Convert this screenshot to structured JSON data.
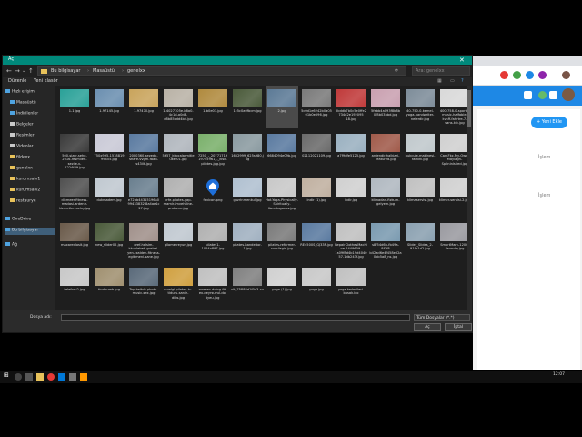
{
  "dialog": {
    "title": "Aç",
    "breadcrumb": [
      "Bu bilgisayar",
      "Masaüstü",
      "genelxx"
    ],
    "search_placeholder": "Ara: genelxx",
    "toolbar": [
      "Düzenle",
      "Yeni klasör"
    ],
    "sidebar": [
      {
        "label": "Hızlı erişim",
        "color": "#4fa3e0"
      },
      {
        "label": "Masaüstü",
        "color": "#4fa3e0"
      },
      {
        "label": "İndirilenler",
        "color": "#4fa3e0"
      },
      {
        "label": "Belgeler",
        "color": "#c9c9c9"
      },
      {
        "label": "Resimler",
        "color": "#c9c9c9"
      },
      {
        "label": "Videolar",
        "color": "#c9c9c9"
      },
      {
        "label": "fildexx",
        "color": "#e8c25a"
      },
      {
        "label": "genelxx",
        "color": "#e8c25a"
      },
      {
        "label": "kurumsalv1",
        "color": "#e8c25a"
      },
      {
        "label": "kurumsalv2",
        "color": "#e8c25a"
      },
      {
        "label": "restaurye",
        "color": "#e8c25a"
      },
      {
        "label": "OneDrive",
        "color": "#4fa3e0"
      },
      {
        "label": "Bu bilgisayar",
        "color": "#4fa3e0",
        "selected": true
      },
      {
        "label": "Ağ",
        "color": "#4fa3e0"
      }
    ],
    "files": [
      {
        "name": "1-1.jpg",
        "color": "#2aa198"
      },
      {
        "name": "1-97145.jpg",
        "color": "#6b8fb0"
      },
      {
        "name": "1-97470.jpg",
        "color": "#c9a45c"
      },
      {
        "name": "1-4027105e-b8a0-4c1d-a0d8-d8b85cdd4b4.jpg",
        "color": "#b9b2a6"
      },
      {
        "name": "1-b0e01.jpg",
        "color": "#b08a3e"
      },
      {
        "name": "1c5c0a0fbcm.jpg",
        "color": "#4a5a3a"
      },
      {
        "name": "2.jpg",
        "color": "#5c7a96",
        "selected": true
      },
      {
        "name": "5c0d1e6242b0a0501b0e596.jpg",
        "color": "#7a7a7a"
      },
      {
        "name": "5bddb7b0c5e0ffe2734d2e192095 18.jpg",
        "color": "#c03a3a"
      },
      {
        "name": "5febb4a093f8b8b 0f8b03bbd.jpg",
        "color": "#c9a0b0"
      },
      {
        "name": "40-750-0-kemel-yoga-handwriter-nelerdir.jpg",
        "color": "#7d8c99"
      },
      {
        "name": "400-758-0-sports-music-halfable-kvsff-fahrtre-7-sans-kik.jpg",
        "color": "#d9d9d9"
      },
      {
        "name": "500-sizer-sehe-2016-resmilerl-sezile-v-2224f69.jpg",
        "color": "#3a3a3a"
      },
      {
        "name": "750x995-1518819 99455.jpg",
        "color": "#c9c9d6"
      },
      {
        "name": "2000360-sezedo-share-vvgm-f8ab-s43ilk.jpg",
        "color": "#5a7aa0"
      },
      {
        "name": "5657_kkocalarmitleuker01.jpg",
        "color": "#b0b6bd"
      },
      {
        "name": "7250_-_20771719 19745961_-_kisd-pilotes-jpg.jpg",
        "color": "#7ab06b"
      },
      {
        "name": "1652999_625s980.jpg",
        "color": "#8a9aa0"
      },
      {
        "name": "6684094e09b.jpg",
        "color": "#5a7aa0"
      },
      {
        "name": "02112021109.jpg",
        "color": "#6a6a6a"
      },
      {
        "name": "a7f9dfe5125.jpg",
        "color": "#9ab0c0"
      },
      {
        "name": "ardendir-halkiari-featured.jpg",
        "color": "#a05a4a"
      },
      {
        "name": "bukcule-makinesi-famini.jpg",
        "color": "#c0c8cc"
      },
      {
        "name": "Can-Fkz-My-Own-Maylagn-Spkninlsired.jpg",
        "color": "#d0d0d0"
      },
      {
        "name": "dikmeer-fitness-madasi-ardenir-hizmetlen-selxy.jpg",
        "color": "#505050"
      },
      {
        "name": "dukmadem.jpg",
        "color": "#c0c8d0"
      },
      {
        "name": "e72bb44315196a099433832f8a4ae1c27.jpg",
        "color": "#6a7f8f"
      },
      {
        "name": "erfe-pilotes-yap-mamir-imvehiline-pratrene.jpg",
        "color": "#b0b0b0"
      },
      {
        "name": "favicon.png",
        "color": "#1e1e1e",
        "icon": true
      },
      {
        "name": "gazrinmenkul.jpg",
        "color": "#b0c0d0"
      },
      {
        "name": "Hot-Yoga-Physically-Spiritually-Kountagoeos.jpg",
        "color": "#c8c8c8"
      },
      {
        "name": "indir (1).jpg",
        "color": "#c0b0a0"
      },
      {
        "name": "indir.jpg",
        "color": "#d0d0d0"
      },
      {
        "name": "klimadan-fizkum-gelyem.jpg",
        "color": "#b0b8c0"
      },
      {
        "name": "klimaservisi.jpg",
        "color": "#c0c0c0"
      },
      {
        "name": "klimer-servisi-2.jpg",
        "color": "#d0d0d0"
      },
      {
        "name": "maxaredlosit.jpg",
        "color": "#6a5a4a"
      },
      {
        "name": "new_slider02.jpg",
        "color": "#4a5a3a"
      },
      {
        "name": "oref-halsim-kkunlebek-gosteli-yen-rzalden-fitness-egitimeni-sane.jpg",
        "color": "#a0908a"
      },
      {
        "name": "pilome-reyun.jpg",
        "color": "#c0c8d0"
      },
      {
        "name": "pilates1-1024x897.jpg",
        "color": "#b0b0b0"
      },
      {
        "name": "pilates-handeltor-1.jpg",
        "color": "#a0b0c0"
      },
      {
        "name": "pilates-reformer-sverlisgin.jpg",
        "color": "#7a7a7a"
      },
      {
        "name": "RE4500S_GJ33R.jpg",
        "color": "#5a7aa0"
      },
      {
        "name": "RepairClothesMachine-1449609-1s09f8d4b19d404057-1db243f.jpg",
        "color": "#c0c0c0"
      },
      {
        "name": "s8f54d6b-fb49a-8f3f8 b42ad6e4f458e52a0bb5a8_ns.jpg",
        "color": "#7a9ab0"
      },
      {
        "name": "Slider_Slides_2-919r1d2.jpg",
        "color": "#8aa0b0"
      },
      {
        "name": "SmartMark-1200-Laundry.jpg",
        "color": "#9a9aa0"
      },
      {
        "name": "teleforv2.jpg",
        "color": "#c8c8c8"
      },
      {
        "name": "tindhumb.jpg",
        "color": "#a09070"
      },
      {
        "name": "Top-twitch-photo-music-sex.jpg",
        "color": "#5a6a7a"
      },
      {
        "name": "vrzalgi-pilates-tu-tiduru-sanie-dibs.jpg",
        "color": "#d0a040"
      },
      {
        "name": "women-doing-fit-ex-deyrsuvul-do-tyeu.jpg",
        "color": "#c0c0c0"
      },
      {
        "name": "xlt_75888d1f0x3-xu",
        "color": "#808080"
      },
      {
        "name": "yoga (1).jpg",
        "color": "#d0d0d0"
      },
      {
        "name": "yoga.jpg",
        "color": "#c8c8c8"
      },
      {
        "name": "yoga-tedavileri-basak.ico",
        "color": "#c0c0c0"
      }
    ],
    "footer": {
      "filename_label": "Dosya adı:",
      "filetype": "Tüm Dosyalar (*.*)",
      "open_label": "Aç",
      "cancel_label": "İptal"
    }
  },
  "background": {
    "button_label": "+ Yeni Ekle",
    "labels": [
      "İşlem",
      "İşlem"
    ]
  },
  "taskbar": {
    "time": "12:07"
  }
}
